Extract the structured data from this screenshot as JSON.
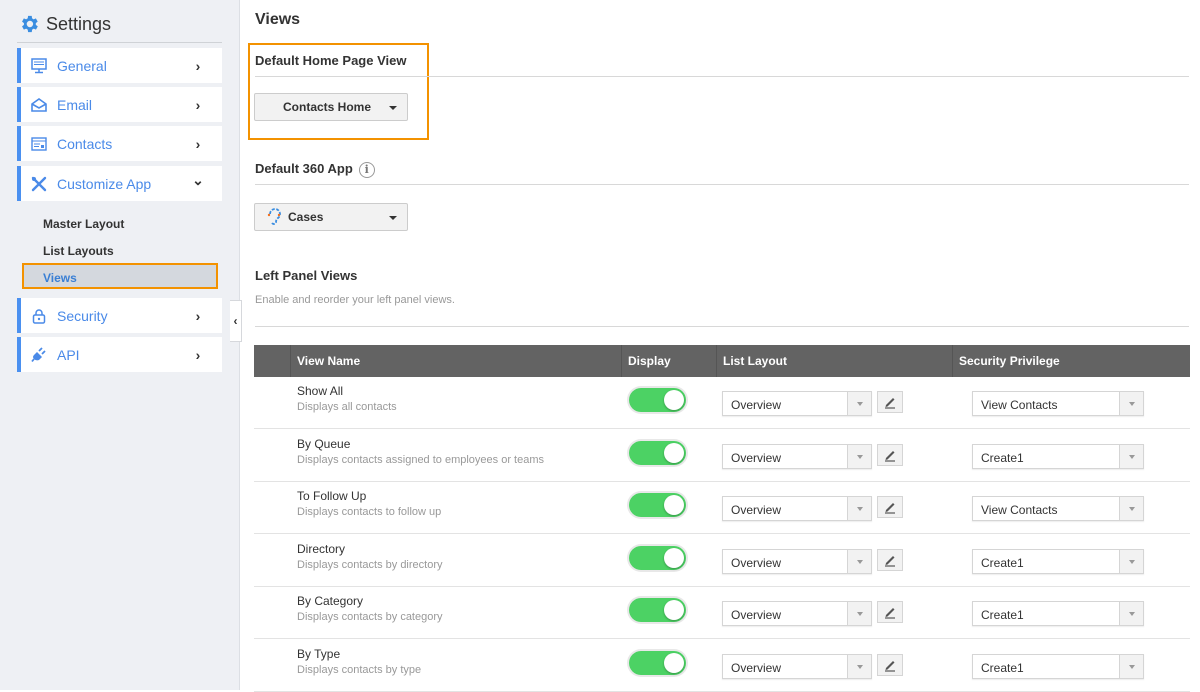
{
  "sidebar": {
    "title": "Settings",
    "items": [
      {
        "label": "General",
        "icon": "monitor-icon",
        "chevron": "›"
      },
      {
        "label": "Email",
        "icon": "envelope-open-icon",
        "chevron": "›"
      },
      {
        "label": "Contacts",
        "icon": "contact-card-icon",
        "chevron": "›"
      },
      {
        "label": "Customize App",
        "icon": "tools-icon",
        "chevron": "⌄"
      },
      {
        "label": "Security",
        "icon": "lock-icon",
        "chevron": "›"
      },
      {
        "label": "API",
        "icon": "plug-icon",
        "chevron": "›"
      }
    ],
    "subitems": [
      "Master Layout",
      "List Layouts",
      "Views"
    ],
    "active_subitem": "Views"
  },
  "main": {
    "title": "Views",
    "default_home": {
      "title": "Default Home Page View",
      "value": "Contacts Home"
    },
    "default_360": {
      "title": "Default 360 App",
      "value": "Cases",
      "info": "i"
    },
    "left_panel": {
      "title": "Left Panel Views",
      "description": "Enable and reorder your left panel views."
    },
    "table": {
      "headers": [
        "View Name",
        "Display",
        "List Layout",
        "Security Privilege"
      ],
      "rows": [
        {
          "name": "Show All",
          "desc": "Displays all contacts",
          "display": true,
          "layout": "Overview",
          "privilege": "View Contacts"
        },
        {
          "name": "By Queue",
          "desc": "Displays contacts assigned to employees or teams",
          "display": true,
          "layout": "Overview",
          "privilege": "Create1"
        },
        {
          "name": "To Follow Up",
          "desc": "Displays contacts to follow up",
          "display": true,
          "layout": "Overview",
          "privilege": "View Contacts"
        },
        {
          "name": "Directory",
          "desc": "Displays contacts by directory",
          "display": true,
          "layout": "Overview",
          "privilege": "Create1"
        },
        {
          "name": "By Category",
          "desc": "Displays contacts by category",
          "display": true,
          "layout": "Overview",
          "privilege": "Create1"
        },
        {
          "name": "By Type",
          "desc": "Displays contacts by type",
          "display": true,
          "layout": "Overview",
          "privilege": "Create1"
        }
      ]
    }
  },
  "colors": {
    "accent": "#4a8ae8",
    "highlight": "#f39200",
    "toggle_on": "#4cd264",
    "header_bg": "#636363"
  }
}
